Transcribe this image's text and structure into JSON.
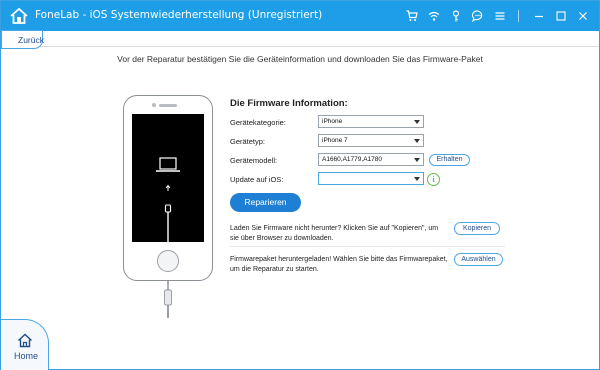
{
  "window": {
    "title": "FoneLab - iOS Systemwiederherstellung (Unregistriert)",
    "accent": "#1e9ee6"
  },
  "toolbar": {
    "icons": [
      "cart-icon",
      "wifi-icon",
      "key-icon",
      "chat-icon",
      "menu-icon",
      "minimize-icon",
      "restore-icon",
      "close-icon"
    ]
  },
  "nav": {
    "back_label": "Zurück",
    "home_label": "Home"
  },
  "instruction": "Vor der Reparatur bestätigen Sie die Geräteinformation und downloaden Sie das Firmware-Paket",
  "firmware": {
    "heading": "Die Firmware Information:",
    "fields": {
      "category": {
        "label": "Gerätekategorie:",
        "value": "iPhone"
      },
      "type": {
        "label": "Gerätetyp:",
        "value": "iPhone 7"
      },
      "model": {
        "label": "Gerätemodell:",
        "value": "A1660,A1779,A1780"
      },
      "ios": {
        "label": "Update auf iOS:",
        "value": ""
      }
    },
    "get_button": "Erhalten",
    "repair_button": "Reparieren"
  },
  "notes": {
    "copy_text": "Laden Sie Firmware nicht herunter? Klicken Sie auf \"Kopieren\", um sie über Browser zu downloaden.",
    "copy_button": "Kopieren",
    "select_text": "Firmwarepaket heruntergeladen! Wählen Sie bitte das Firmwarepaket, um die Reparatur zu starten.",
    "select_button": "Auswählen"
  }
}
